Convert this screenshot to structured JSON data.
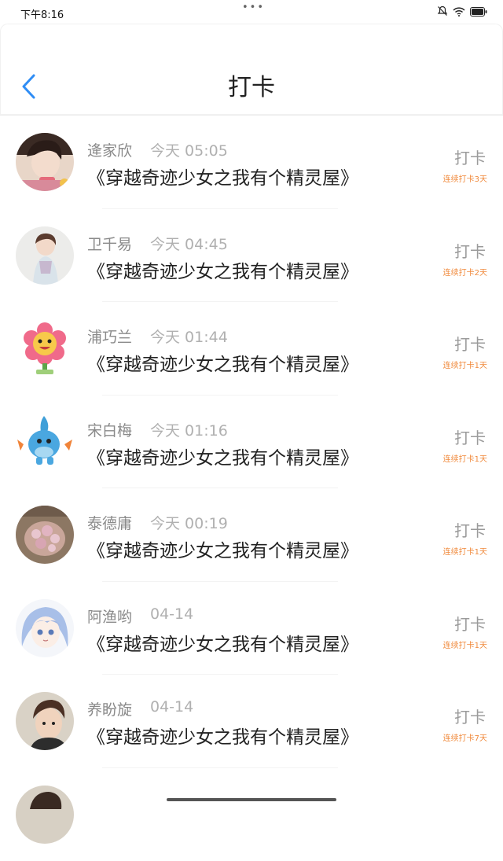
{
  "status_bar": {
    "time": "下午8:16",
    "icons": [
      "mute-icon",
      "wifi-icon",
      "battery-icon"
    ]
  },
  "header": {
    "title": "打卡",
    "back_icon": "chevron-left-icon",
    "accent": "#2f8df5"
  },
  "checkin_colors": {
    "label": "#9b9b9b",
    "streak": "#f08a3c"
  },
  "items": [
    {
      "name": "逄家欣",
      "time": "今天 05:05",
      "book": "《穿越奇迹少女之我有个精灵屋》",
      "action": "打卡",
      "streak": "连续打卡3天"
    },
    {
      "name": "卫千易",
      "time": "今天 04:45",
      "book": "《穿越奇迹少女之我有个精灵屋》",
      "action": "打卡",
      "streak": "连续打卡2天"
    },
    {
      "name": "浦巧兰",
      "time": "今天 01:44",
      "book": "《穿越奇迹少女之我有个精灵屋》",
      "action": "打卡",
      "streak": "连续打卡1天"
    },
    {
      "name": "宋白梅",
      "time": "今天 01:16",
      "book": "《穿越奇迹少女之我有个精灵屋》",
      "action": "打卡",
      "streak": "连续打卡1天"
    },
    {
      "name": "泰德庸",
      "time": "今天 00:19",
      "book": "《穿越奇迹少女之我有个精灵屋》",
      "action": "打卡",
      "streak": "连续打卡1天"
    },
    {
      "name": "阿渔哟",
      "time": "04-14",
      "book": "《穿越奇迹少女之我有个精灵屋》",
      "action": "打卡",
      "streak": "连续打卡1天"
    },
    {
      "name": "养盼旋",
      "time": "04-14",
      "book": "《穿越奇迹少女之我有个精灵屋》",
      "action": "打卡",
      "streak": "连续打卡7天"
    }
  ]
}
